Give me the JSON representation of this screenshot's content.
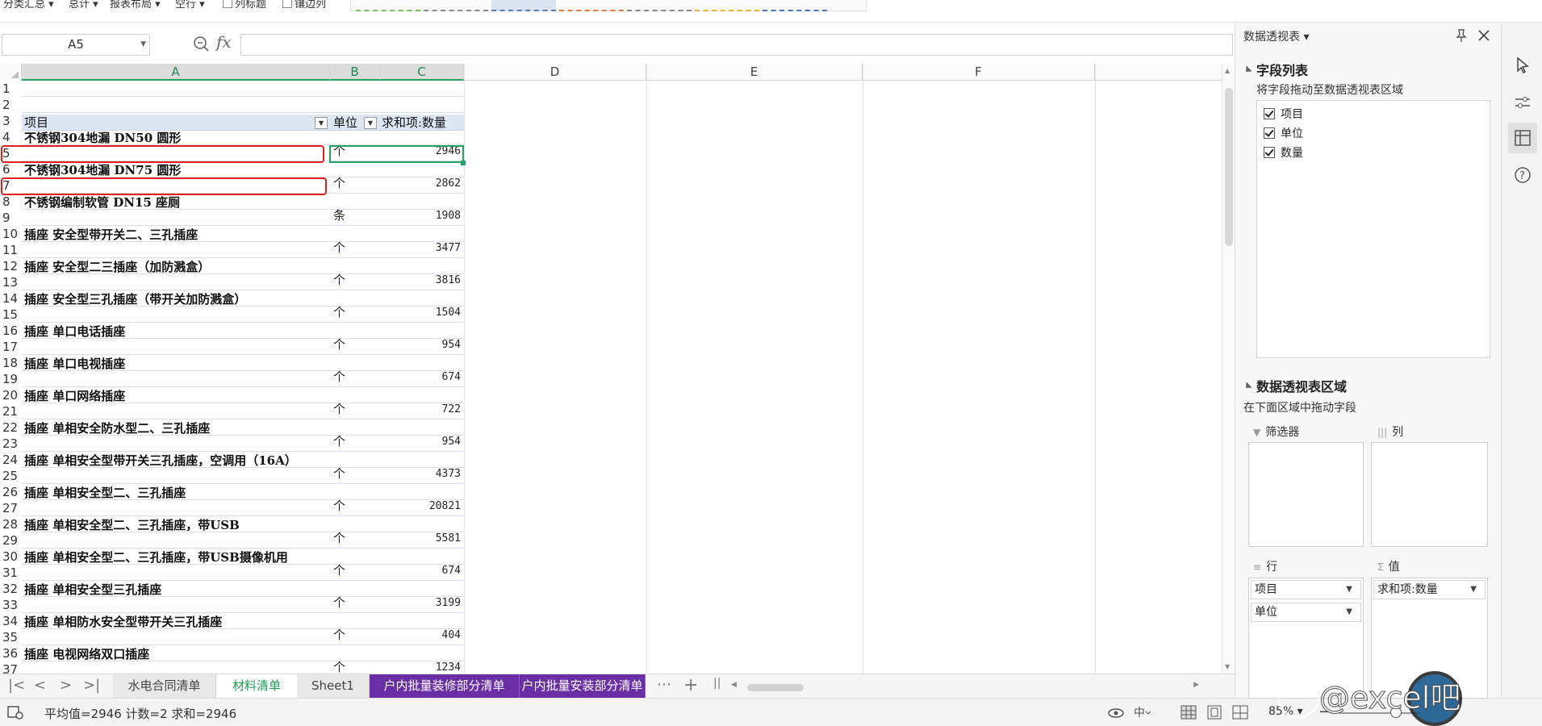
{
  "ribbon": {
    "items": [
      "分类汇总",
      "总计",
      "报表布局",
      "空行"
    ],
    "checkbox1": "列标题",
    "checkbox2": "镶边列"
  },
  "formula_bar": {
    "name_box": "A5",
    "fx_label": "fx",
    "formula": ""
  },
  "columns": [
    {
      "label": "A",
      "selected": true
    },
    {
      "label": "B",
      "selected": true
    },
    {
      "label": "C",
      "selected": true
    },
    {
      "label": "D",
      "selected": false
    },
    {
      "label": "E",
      "selected": false
    },
    {
      "label": "F",
      "selected": false
    }
  ],
  "pivot_header": {
    "item": "项目",
    "unit": "单位",
    "sum": "求和项:数量"
  },
  "rows": [
    {
      "n": "1",
      "a": "",
      "b": "",
      "c": ""
    },
    {
      "n": "2",
      "a": "",
      "b": "",
      "c": ""
    },
    {
      "n": "3",
      "a": "",
      "b": "",
      "c": ""
    },
    {
      "n": "4",
      "a": "不锈钢304地漏 DN50 圆形",
      "b": "",
      "c": ""
    },
    {
      "n": "5",
      "a": "",
      "b": "个",
      "c": "2946"
    },
    {
      "n": "6",
      "a": "不锈钢304地漏 DN75 圆形",
      "b": "",
      "c": ""
    },
    {
      "n": "7",
      "a": "",
      "b": "个",
      "c": "2862"
    },
    {
      "n": "8",
      "a": "不锈钢编制软管 DN15 座厕",
      "b": "",
      "c": ""
    },
    {
      "n": "9",
      "a": "",
      "b": "条",
      "c": "1908"
    },
    {
      "n": "10",
      "a": "插座 安全型带开关二、三孔插座",
      "b": "",
      "c": ""
    },
    {
      "n": "11",
      "a": "",
      "b": "个",
      "c": "3477"
    },
    {
      "n": "12",
      "a": "插座 安全型二三插座（加防溅盒）",
      "b": "",
      "c": ""
    },
    {
      "n": "13",
      "a": "",
      "b": "个",
      "c": "3816"
    },
    {
      "n": "14",
      "a": "插座 安全型三孔插座（带开关加防溅盒）",
      "b": "",
      "c": ""
    },
    {
      "n": "15",
      "a": "",
      "b": "个",
      "c": "1504"
    },
    {
      "n": "16",
      "a": "插座 单口电话插座",
      "b": "",
      "c": ""
    },
    {
      "n": "17",
      "a": "",
      "b": "个",
      "c": "954"
    },
    {
      "n": "18",
      "a": "插座 单口电视插座",
      "b": "",
      "c": ""
    },
    {
      "n": "19",
      "a": "",
      "b": "个",
      "c": "674"
    },
    {
      "n": "20",
      "a": "插座 单口网络插座",
      "b": "",
      "c": ""
    },
    {
      "n": "21",
      "a": "",
      "b": "个",
      "c": "722"
    },
    {
      "n": "22",
      "a": "插座 单相安全防水型二、三孔插座",
      "b": "",
      "c": ""
    },
    {
      "n": "23",
      "a": "",
      "b": "个",
      "c": "954"
    },
    {
      "n": "24",
      "a": "插座 单相安全型带开关三孔插座，空调用（16A）",
      "b": "",
      "c": ""
    },
    {
      "n": "25",
      "a": "",
      "b": "个",
      "c": "4373"
    },
    {
      "n": "26",
      "a": "插座 单相安全型二、三孔插座",
      "b": "",
      "c": ""
    },
    {
      "n": "27",
      "a": "",
      "b": "个",
      "c": "20821"
    },
    {
      "n": "28",
      "a": "插座 单相安全型二、三孔插座，带USB",
      "b": "",
      "c": ""
    },
    {
      "n": "29",
      "a": "",
      "b": "个",
      "c": "5581"
    },
    {
      "n": "30",
      "a": "插座 单相安全型二、三孔插座，带USB摄像机用",
      "b": "",
      "c": ""
    },
    {
      "n": "31",
      "a": "",
      "b": "个",
      "c": "674"
    },
    {
      "n": "32",
      "a": "插座 单相安全型三孔插座",
      "b": "",
      "c": ""
    },
    {
      "n": "33",
      "a": "",
      "b": "个",
      "c": "3199"
    },
    {
      "n": "34",
      "a": "插座 单相防水安全型带开关三孔插座",
      "b": "",
      "c": ""
    },
    {
      "n": "35",
      "a": "",
      "b": "个",
      "c": "404"
    },
    {
      "n": "36",
      "a": "插座 电视网络双口插座",
      "b": "",
      "c": ""
    },
    {
      "n": "37",
      "a": "",
      "b": "个",
      "c": "1234"
    }
  ],
  "sheet_tabs": [
    {
      "label": "水电合同清单",
      "style": "plain"
    },
    {
      "label": "材料清单",
      "style": "active"
    },
    {
      "label": "Sheet1",
      "style": "plain"
    },
    {
      "label": "户内批量装修部分清单",
      "style": "purple"
    },
    {
      "label": "户内批量安装部分清单",
      "style": "purple"
    }
  ],
  "tabs_more": "⋯",
  "tabs_add": "+",
  "status": {
    "summary": "平均值=2946  计数=2  求和=2946",
    "zoom": "85%"
  },
  "panel": {
    "title": "数据透视表",
    "field_list_title": "字段列表",
    "field_list_hint": "将字段拖动至数据透视表区域",
    "fields": [
      "项目",
      "单位",
      "数量"
    ],
    "areas_title": "数据透视表区域",
    "areas_hint": "在下面区域中拖动字段",
    "filter_label": "筛选器",
    "columns_label": "列",
    "rows_label": "行",
    "values_label": "值",
    "row_fields": [
      "项目",
      "单位"
    ],
    "value_fields": [
      "求和项:数量"
    ]
  },
  "watermark": "@excel吧",
  "colors": {
    "accent": "#21a366",
    "purple_tab": "#6a2fa5",
    "highlight_red": "#e21f1f",
    "pivot_header_bg": "#dde7f3"
  }
}
